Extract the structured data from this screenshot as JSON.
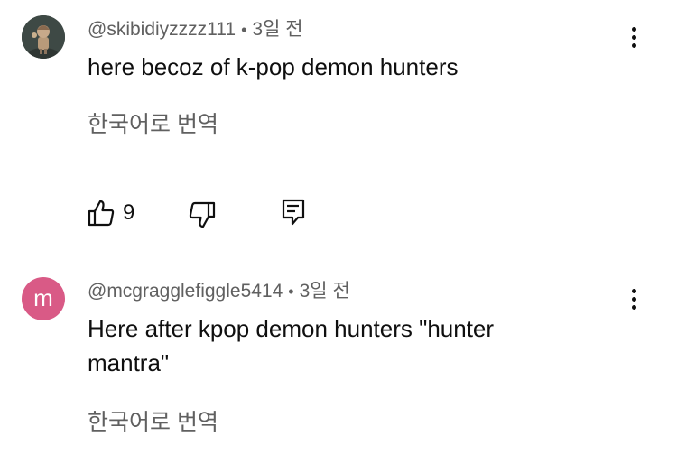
{
  "comments": [
    {
      "handle": "@skibidiyzzzz111",
      "separator": "•",
      "time": "3일 전",
      "text": "here becoz of k-pop demon hunters",
      "translate_label": "한국어로 번역",
      "like_count": "9",
      "avatar_type": "photo"
    },
    {
      "handle": "@mcgragglefiggle5414",
      "separator": "•",
      "time": "3일 전",
      "text": "Here after kpop demon hunters \"hunter mantra\"",
      "translate_label": "한국어로 번역",
      "avatar_letter": "m",
      "avatar_color": "#d95a86"
    }
  ],
  "icons": {
    "like": "thumbs-up-icon",
    "dislike": "thumbs-down-icon",
    "reply": "reply-icon",
    "more": "more-vertical-icon"
  }
}
